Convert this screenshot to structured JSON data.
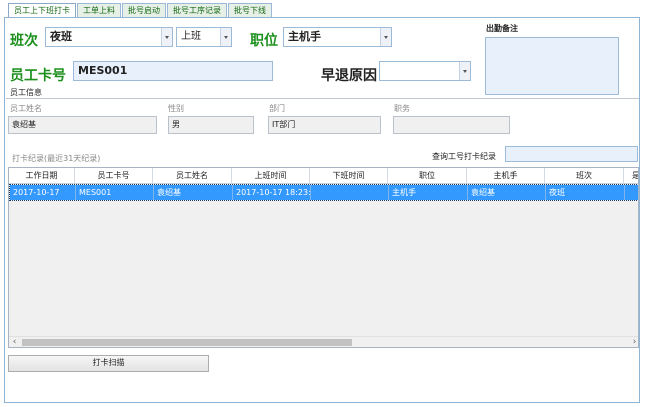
{
  "tabs": [
    "员工上下班打卡",
    "工单上料",
    "批号启动",
    "批号工序记录",
    "批号下线"
  ],
  "shift": {
    "label": "班次",
    "value": "夜班",
    "type_value": "上班"
  },
  "position": {
    "label": "职位",
    "value": "主机手"
  },
  "attendance_note": {
    "label": "出勤备注",
    "value": ""
  },
  "card": {
    "label": "员工卡号",
    "value": "MES001"
  },
  "early_leave": {
    "label": "早退原因",
    "value": ""
  },
  "employee_info": {
    "section_label": "员工信息",
    "name_label": "员工姓名",
    "name_value": "袁绍基",
    "gender_label": "性别",
    "gender_value": "男",
    "dept_label": "部门",
    "dept_value": "IT部门",
    "title_label": "职务",
    "title_value": ""
  },
  "records": {
    "title": "打卡纪录(最近31天纪录)",
    "query_label": "查询工号打卡纪录",
    "query_value": "",
    "columns": [
      "工作日期",
      "员工卡号",
      "员工姓名",
      "上班时间",
      "下班时间",
      "职位",
      "主机手",
      "班次",
      "是"
    ],
    "rows": [
      [
        "2017-10-17",
        "MES001",
        "袁绍基",
        "2017-10-17 18:23:",
        "",
        "主机手",
        "袁绍基",
        "夜班",
        ""
      ]
    ]
  },
  "scan_button": "打卡扫描",
  "icons": [
    "chevron-down-icon",
    "chevron-left-icon",
    "chevron-right-icon"
  ]
}
